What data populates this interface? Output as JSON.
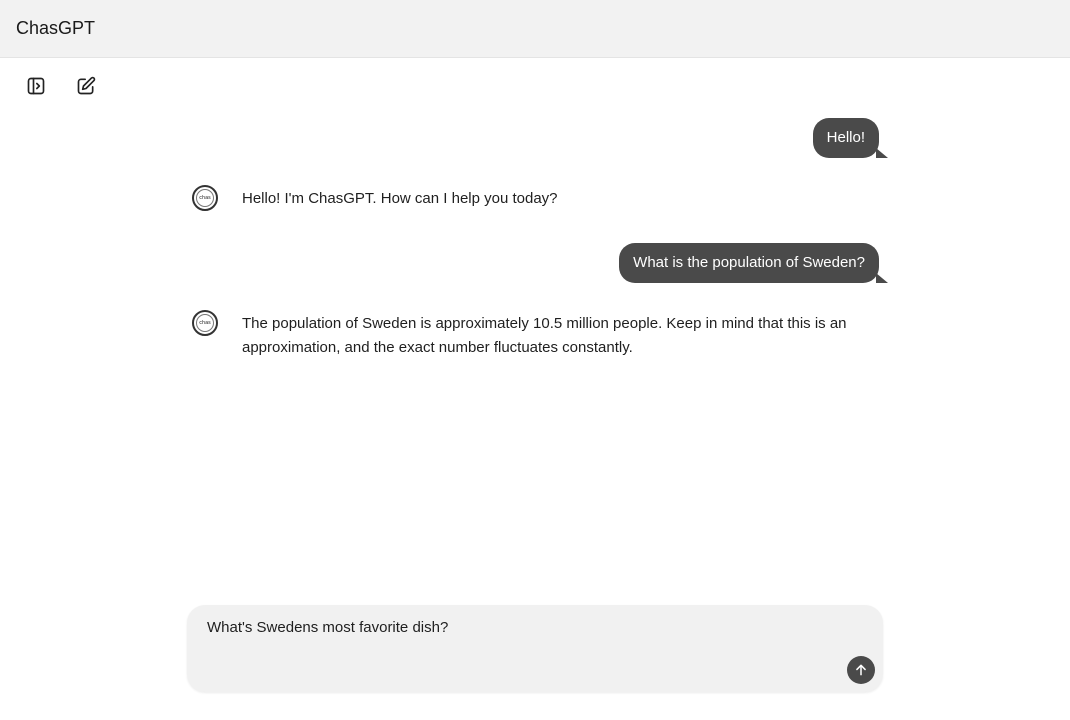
{
  "app": {
    "title": "ChasGPT"
  },
  "toolbar": {
    "sidebar_icon": "sidebar-toggle-icon",
    "new_chat_icon": "edit-icon"
  },
  "conversation": {
    "messages": [
      {
        "role": "user",
        "text": "Hello!"
      },
      {
        "role": "assistant",
        "avatar_text": "chas",
        "text": "Hello! I'm ChasGPT. How can I help you today?"
      },
      {
        "role": "user",
        "text": "What is the population of Sweden?"
      },
      {
        "role": "assistant",
        "avatar_text": "chas",
        "text": "The population of Sweden is approximately 10.5 million people.  Keep in mind that this is an approximation, and the exact number fluctuates constantly."
      }
    ]
  },
  "composer": {
    "value": "What's Swedens most favorite dish?",
    "send_icon": "arrow-up-icon"
  },
  "colors": {
    "header_bg": "#f2f2f2",
    "bubble_bg": "#4a4a4a",
    "composer_bg": "#f1f1f1"
  }
}
